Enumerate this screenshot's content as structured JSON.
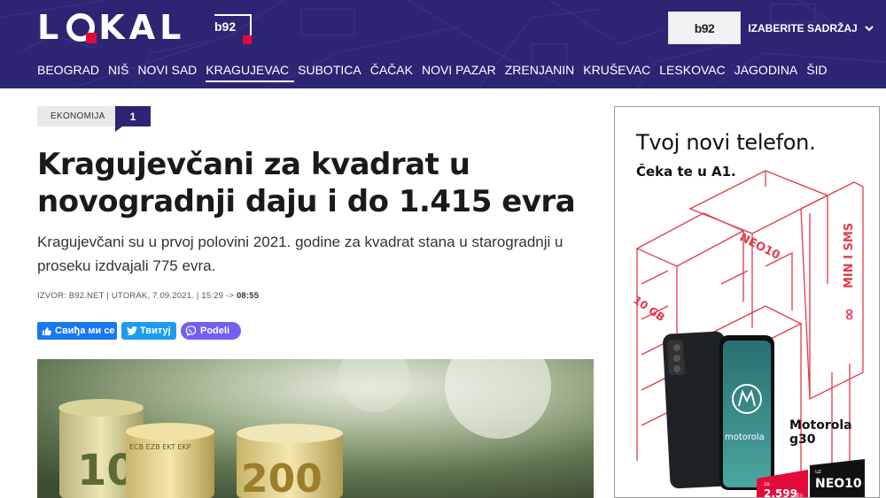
{
  "header": {
    "logo_text": "LOKAL",
    "logo_badge": "b92",
    "b92_button": "b92",
    "content_select": "IZABERITE SADRŽAJ",
    "nav": [
      "BEOGRAD",
      "NIŠ",
      "NOVI SAD",
      "KRAGUJEVAC",
      "SUBOTICA",
      "ČAČAK",
      "NOVI PAZAR",
      "ZRENJANIN",
      "KRUŠEVAC",
      "LESKOVAC",
      "JAGODINA",
      "ŠID"
    ],
    "active_nav": "KRAGUJEVAC"
  },
  "article": {
    "category": "EKONOMIJA",
    "comment_count": "1",
    "title": "Kragujevčani za kvadrat u novogradnji daju i do 1.415 evra",
    "lead": "Kragujevčani su u prvoj polovini 2021. godine za kvadrat stana u starogradnji u proseku izdvajali 775 evra.",
    "meta_source": "IZVOR: B92.NET",
    "meta_date": " | UTORAK, 7.09.2021. | 15:29 -> ",
    "meta_updated": "08:55",
    "share": {
      "facebook": "Свиђа ми се",
      "twitter": "Твитуј",
      "viber": "Podeli"
    },
    "photo_texts": [
      "ECB EZB EKT EKP",
      "100",
      "200"
    ]
  },
  "ad": {
    "headline": "Tvoj novi telefon.",
    "subline": "Čeka te u A1.",
    "tag_neo": "NEO10",
    "tag_gb": "10 GB",
    "tag_min": "MIN I SMS",
    "phone_name_1": "Motorola",
    "phone_name_2": "g30",
    "phone_brand": "motorola",
    "price": "2.599",
    "price_prefix": "za",
    "price_suffix": "din",
    "plan_prefix": "uz",
    "plan": "NEO10",
    "colors": {
      "accent": "#e30a3a",
      "outline": "#e4394a"
    }
  }
}
